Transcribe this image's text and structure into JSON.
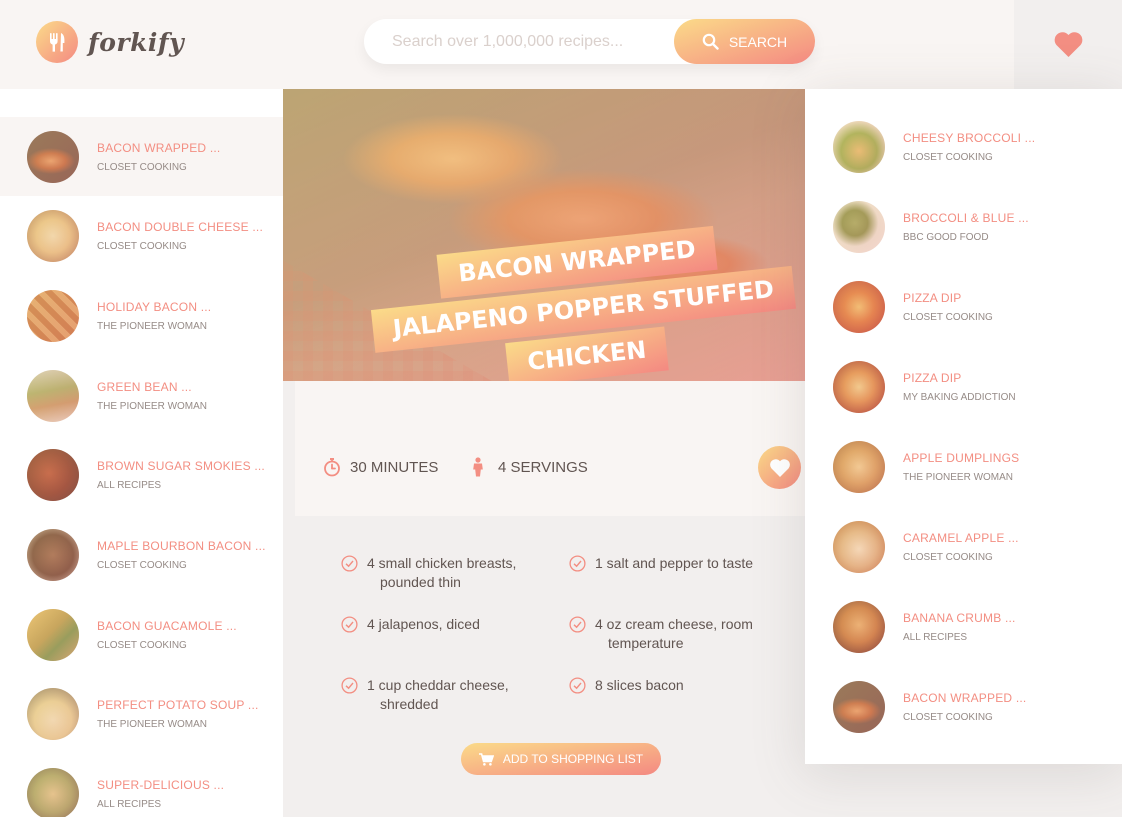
{
  "header": {
    "logo_text": "forkify",
    "search_placeholder": "Search over 1,000,000 recipes...",
    "search_button": "Search"
  },
  "results": [
    {
      "title": "Bacon Wrapped ...",
      "author": "Closet Cooking",
      "active": true
    },
    {
      "title": "Bacon Double Cheese ...",
      "author": "Closet Cooking"
    },
    {
      "title": "Holiday Bacon ...",
      "author": "The Pioneer Woman"
    },
    {
      "title": "Green Bean ...",
      "author": "The Pioneer Woman"
    },
    {
      "title": "Brown Sugar Smokies ...",
      "author": "All Recipes"
    },
    {
      "title": "Maple Bourbon Bacon ...",
      "author": "Closet Cooking"
    },
    {
      "title": "Bacon Guacamole ...",
      "author": "Closet Cooking"
    },
    {
      "title": "Perfect Potato Soup ...",
      "author": "The Pioneer Woman"
    },
    {
      "title": "Super-Delicious ...",
      "author": "All Recipes"
    }
  ],
  "recipe": {
    "title_lines": [
      "Bacon Wrapped",
      "Jalapeno Popper Stuffed",
      "Chicken"
    ],
    "time": "30 minutes",
    "servings": "4 servings",
    "ingredients": [
      {
        "line1": "4 small chicken breasts,",
        "line2": "pounded thin"
      },
      {
        "line1": "1 salt and pepper to taste",
        "line2": ""
      },
      {
        "line1": "4 jalapenos, diced",
        "line2": ""
      },
      {
        "line1": "4 oz cream cheese, room",
        "line2": "temperature"
      },
      {
        "line1": "1 cup cheddar cheese,",
        "line2": "shredded"
      },
      {
        "line1": "8 slices bacon",
        "line2": ""
      }
    ],
    "shopping_button": "Add to shopping list"
  },
  "likes": [
    {
      "title": "Cheesy Broccoli ...",
      "author": "Closet Cooking"
    },
    {
      "title": "Broccoli & Blue ...",
      "author": "BBC Good Food"
    },
    {
      "title": "Pizza Dip",
      "author": "Closet Cooking"
    },
    {
      "title": "Pizza Dip",
      "author": "My Baking Addiction"
    },
    {
      "title": "Apple Dumplings",
      "author": "The Pioneer Woman"
    },
    {
      "title": "Caramel Apple ...",
      "author": "Closet Cooking"
    },
    {
      "title": "Banana Crumb ...",
      "author": "All Recipes"
    },
    {
      "title": "Bacon Wrapped ...",
      "author": "Closet Cooking"
    }
  ],
  "colors": {
    "accent": "#f38e82",
    "gradient_start": "#fbdb89",
    "gradient_end": "#f48982",
    "text": "#615551",
    "muted": "#968b87"
  },
  "icons": {
    "logo": "fork-knife-icon",
    "search": "search-icon",
    "likes": "heart-icon",
    "time": "stopwatch-icon",
    "servings": "person-icon",
    "ingredient": "check-circle-icon",
    "cart": "cart-icon"
  }
}
